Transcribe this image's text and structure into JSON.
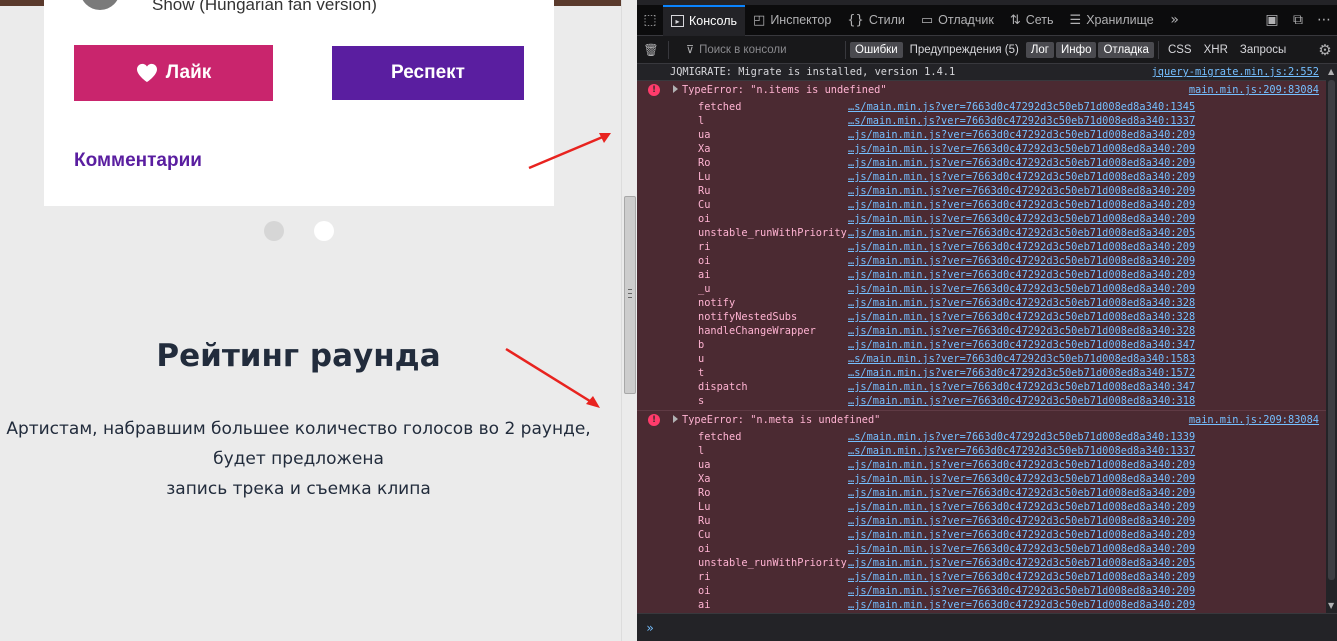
{
  "page": {
    "track_fragment": "Show (Hungarian fan version)",
    "like_label": "Лайк",
    "respect_label": "Респект",
    "comments_label": "Комментарии",
    "rating_title": "Рейтинг раунда",
    "rating_lines": [
      "Артистам, набравшим большее количество голосов во 2 раунде,",
      "будет предложена",
      "запись трека и съемка клипа"
    ],
    "colors": {
      "like": "#c9256d",
      "respect": "#5a1ea0",
      "arrow": "#e8231f"
    }
  },
  "devtools": {
    "tabs": [
      {
        "label": "Консоль",
        "icon": "console-icon",
        "active": true
      },
      {
        "label": "Инспектор",
        "icon": "inspector-icon",
        "active": false
      },
      {
        "label": "Стили",
        "icon": "braces-icon",
        "active": false
      },
      {
        "label": "Отладчик",
        "icon": "debugger-icon",
        "active": false
      },
      {
        "label": "Сеть",
        "icon": "network-icon",
        "active": false
      },
      {
        "label": "Хранилище",
        "icon": "storage-icon",
        "active": false
      }
    ],
    "more_tabs_symbol": "»",
    "filter_placeholder": "Поиск в консоли",
    "filters": [
      {
        "label": "Ошибки",
        "on": true
      },
      {
        "label": "Предупреждения (5)",
        "on": false
      },
      {
        "label": "Лог",
        "on": true
      },
      {
        "label": "Инфо",
        "on": true
      },
      {
        "label": "Отладка",
        "on": true
      },
      {
        "label": "CSS",
        "on": false
      },
      {
        "label": "XHR",
        "on": false
      },
      {
        "label": "Запросы",
        "on": false
      }
    ],
    "log_message": {
      "text": "JQMIGRATE: Migrate is installed, version 1.4.1",
      "source": "jquery-migrate.min.js:2:552"
    },
    "errors": [
      {
        "message": "TypeError: \"n.items is undefined\"",
        "source": "main.min.js:209:83084",
        "frames": [
          {
            "fn": "fetched",
            "loc": "…s/main.min.js?ver=7663d0c47292d3c50eb71d008ed8a340:1345"
          },
          {
            "fn": "l",
            "loc": "…s/main.min.js?ver=7663d0c47292d3c50eb71d008ed8a340:1337"
          },
          {
            "fn": "ua",
            "loc": "…js/main.min.js?ver=7663d0c47292d3c50eb71d008ed8a340:209"
          },
          {
            "fn": "Xa",
            "loc": "…js/main.min.js?ver=7663d0c47292d3c50eb71d008ed8a340:209"
          },
          {
            "fn": "Ro",
            "loc": "…js/main.min.js?ver=7663d0c47292d3c50eb71d008ed8a340:209"
          },
          {
            "fn": "Lu",
            "loc": "…js/main.min.js?ver=7663d0c47292d3c50eb71d008ed8a340:209"
          },
          {
            "fn": "Ru",
            "loc": "…js/main.min.js?ver=7663d0c47292d3c50eb71d008ed8a340:209"
          },
          {
            "fn": "Cu",
            "loc": "…js/main.min.js?ver=7663d0c47292d3c50eb71d008ed8a340:209"
          },
          {
            "fn": "oi",
            "loc": "…js/main.min.js?ver=7663d0c47292d3c50eb71d008ed8a340:209"
          },
          {
            "fn": "unstable_runWithPriority",
            "loc": "…js/main.min.js?ver=7663d0c47292d3c50eb71d008ed8a340:205"
          },
          {
            "fn": "ri",
            "loc": "…js/main.min.js?ver=7663d0c47292d3c50eb71d008ed8a340:209"
          },
          {
            "fn": "oi",
            "loc": "…js/main.min.js?ver=7663d0c47292d3c50eb71d008ed8a340:209"
          },
          {
            "fn": "ai",
            "loc": "…js/main.min.js?ver=7663d0c47292d3c50eb71d008ed8a340:209"
          },
          {
            "fn": "_u",
            "loc": "…js/main.min.js?ver=7663d0c47292d3c50eb71d008ed8a340:209"
          },
          {
            "fn": "notify",
            "loc": "…js/main.min.js?ver=7663d0c47292d3c50eb71d008ed8a340:328"
          },
          {
            "fn": "notifyNestedSubs",
            "loc": "…js/main.min.js?ver=7663d0c47292d3c50eb71d008ed8a340:328"
          },
          {
            "fn": "handleChangeWrapper",
            "loc": "…js/main.min.js?ver=7663d0c47292d3c50eb71d008ed8a340:328"
          },
          {
            "fn": "b",
            "loc": "…js/main.min.js?ver=7663d0c47292d3c50eb71d008ed8a340:347"
          },
          {
            "fn": "u",
            "loc": "…s/main.min.js?ver=7663d0c47292d3c50eb71d008ed8a340:1583"
          },
          {
            "fn": "t",
            "loc": "…s/main.min.js?ver=7663d0c47292d3c50eb71d008ed8a340:1572"
          },
          {
            "fn": "dispatch",
            "loc": "…js/main.min.js?ver=7663d0c47292d3c50eb71d008ed8a340:347"
          },
          {
            "fn": "s",
            "loc": "…js/main.min.js?ver=7663d0c47292d3c50eb71d008ed8a340:318"
          }
        ]
      },
      {
        "message": "TypeError: \"n.meta is undefined\"",
        "source": "main.min.js:209:83084",
        "frames": [
          {
            "fn": "fetched",
            "loc": "…s/main.min.js?ver=7663d0c47292d3c50eb71d008ed8a340:1339"
          },
          {
            "fn": "l",
            "loc": "…s/main.min.js?ver=7663d0c47292d3c50eb71d008ed8a340:1337"
          },
          {
            "fn": "ua",
            "loc": "…js/main.min.js?ver=7663d0c47292d3c50eb71d008ed8a340:209"
          },
          {
            "fn": "Xa",
            "loc": "…js/main.min.js?ver=7663d0c47292d3c50eb71d008ed8a340:209"
          },
          {
            "fn": "Ro",
            "loc": "…js/main.min.js?ver=7663d0c47292d3c50eb71d008ed8a340:209"
          },
          {
            "fn": "Lu",
            "loc": "…js/main.min.js?ver=7663d0c47292d3c50eb71d008ed8a340:209"
          },
          {
            "fn": "Ru",
            "loc": "…js/main.min.js?ver=7663d0c47292d3c50eb71d008ed8a340:209"
          },
          {
            "fn": "Cu",
            "loc": "…js/main.min.js?ver=7663d0c47292d3c50eb71d008ed8a340:209"
          },
          {
            "fn": "oi",
            "loc": "…js/main.min.js?ver=7663d0c47292d3c50eb71d008ed8a340:209"
          },
          {
            "fn": "unstable_runWithPriority",
            "loc": "…js/main.min.js?ver=7663d0c47292d3c50eb71d008ed8a340:205"
          },
          {
            "fn": "ri",
            "loc": "…js/main.min.js?ver=7663d0c47292d3c50eb71d008ed8a340:209"
          },
          {
            "fn": "oi",
            "loc": "…js/main.min.js?ver=7663d0c47292d3c50eb71d008ed8a340:209"
          },
          {
            "fn": "ai",
            "loc": "…js/main.min.js?ver=7663d0c47292d3c50eb71d008ed8a340:209"
          }
        ]
      }
    ],
    "input_prompt": "»"
  }
}
